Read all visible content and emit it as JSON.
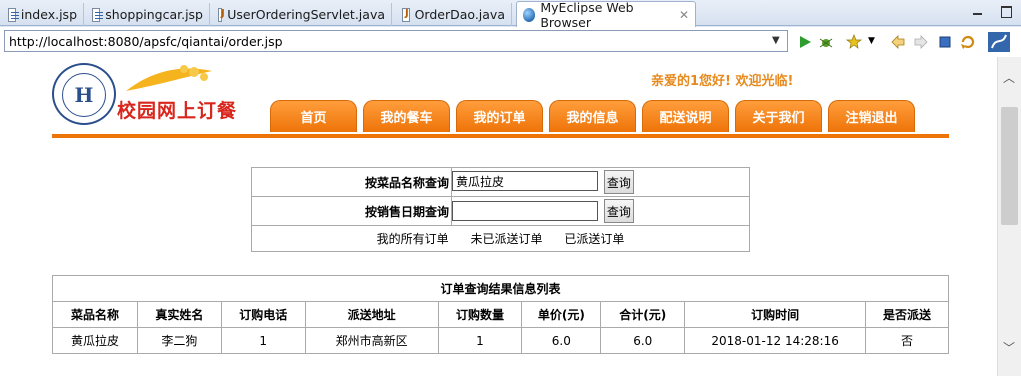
{
  "tabs": [
    {
      "label": "index.jsp",
      "icon": "jsp-file-icon"
    },
    {
      "label": "shoppingcar.jsp",
      "icon": "jsp-file-icon"
    },
    {
      "label": "UserOrderingServlet.java",
      "icon": "java-file-icon"
    },
    {
      "label": "OrderDao.java",
      "icon": "java-file-icon"
    },
    {
      "label": "MyEclipse Web Browser",
      "icon": "globe-icon",
      "active": true
    }
  ],
  "address": {
    "url": "http://localhost:8080/apsfc/qiantai/order.jsp"
  },
  "page": {
    "brand": "校园网上订餐",
    "welcome": "亲爱的1您好!  欢迎光临!",
    "menu": [
      "首页",
      "我的餐车",
      "我的订单",
      "我的信息",
      "配送说明",
      "关于我们",
      "注销退出"
    ],
    "search": {
      "name_label": "按菜品名称查询",
      "name_value": "黄瓜拉皮",
      "date_label": "按销售日期查询",
      "date_value": "",
      "query_btn": "查询",
      "links": [
        "我的所有订单",
        "未已派送订单",
        "已派送订单"
      ]
    },
    "results": {
      "caption": "订单查询结果信息列表",
      "headers": [
        "菜品名称",
        "真实姓名",
        "订购电话",
        "派送地址",
        "订购数量",
        "单价(元)",
        "合计(元)",
        "订购时间",
        "是否派送"
      ],
      "rows": [
        [
          "黄瓜拉皮",
          "李二狗",
          "1",
          "郑州市高新区",
          "1",
          "6.0",
          "6.0",
          "2018-01-12 14:28:16",
          "否"
        ]
      ]
    }
  },
  "colors": {
    "accent": "#ee7408",
    "brand": "#d9261c",
    "welcome": "#e68a1e"
  }
}
